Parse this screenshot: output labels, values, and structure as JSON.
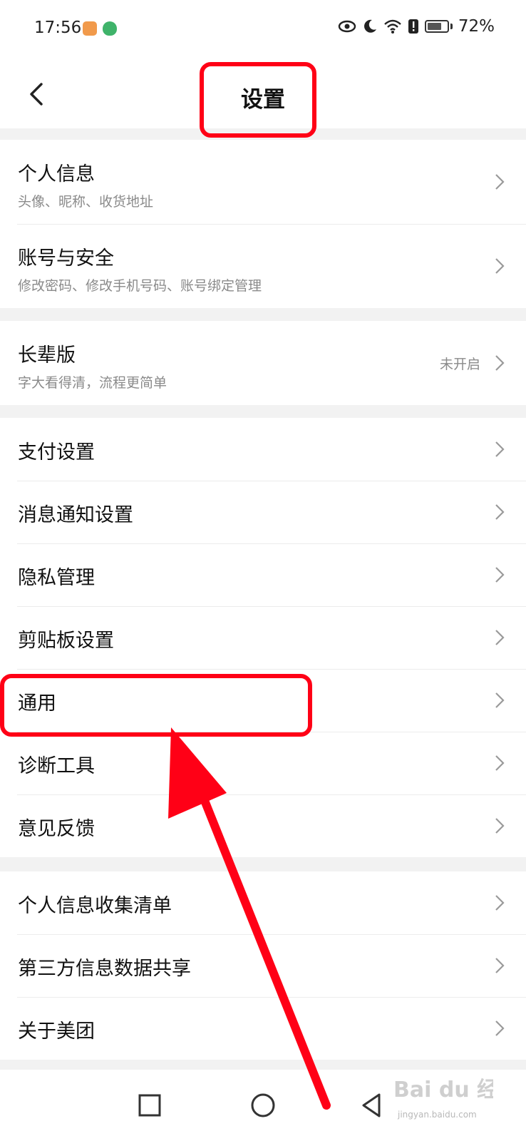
{
  "status_bar": {
    "time": "17:56",
    "battery": "72%",
    "battery_level": 0.72,
    "icons": [
      "eye-icon",
      "moon-icon",
      "wifi-icon",
      "alert-icon",
      "battery-icon"
    ]
  },
  "header": {
    "title": "设置",
    "back_icon": "chevron-left-icon"
  },
  "groups": {
    "account": [
      {
        "label": "个人信息",
        "sub": "头像、昵称、收货地址"
      },
      {
        "label": "账号与安全",
        "sub": "修改密码、修改手机号码、账号绑定管理"
      }
    ],
    "elder": {
      "label": "长辈版",
      "sub": "字大看得清，流程更简单",
      "status": "未开启"
    },
    "settings": [
      {
        "label": "支付设置"
      },
      {
        "label": "消息通知设置"
      },
      {
        "label": "隐私管理"
      },
      {
        "label": "剪贴板设置"
      },
      {
        "label": "通用"
      },
      {
        "label": "诊断工具"
      },
      {
        "label": "意见反馈"
      }
    ],
    "info": [
      {
        "label": "个人信息收集清单"
      },
      {
        "label": "第三方信息数据共享"
      },
      {
        "label": "关于美团"
      }
    ]
  },
  "nav": {
    "icons": [
      "recent-apps-icon",
      "home-icon",
      "back-triangle-icon"
    ]
  },
  "annotation": {
    "color": "#ff0016"
  },
  "watermark": {
    "logo_text": "Bai du 经验",
    "url": "jingyan.baidu.com"
  }
}
